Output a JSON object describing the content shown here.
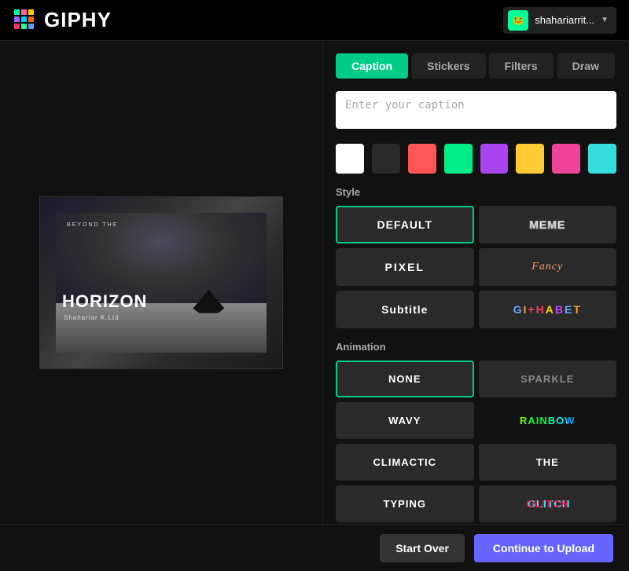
{
  "header": {
    "logo_text": "GIPHY",
    "user_name": "shahariarrit...",
    "user_avatar_emoji": "🐸",
    "chevron": "▼"
  },
  "tabs": [
    {
      "id": "caption",
      "label": "Caption",
      "active": true
    },
    {
      "id": "stickers",
      "label": "Stickers",
      "active": false
    },
    {
      "id": "filters",
      "label": "Filters",
      "active": false
    },
    {
      "id": "draw",
      "label": "Draw",
      "active": false
    }
  ],
  "caption": {
    "placeholder": "Enter your caption",
    "value": ""
  },
  "colors": [
    {
      "id": "white",
      "hex": "#ffffff",
      "active": true
    },
    {
      "id": "black",
      "hex": "#2a2a2a",
      "active": false
    },
    {
      "id": "red",
      "hex": "#ff5555",
      "active": false
    },
    {
      "id": "green",
      "hex": "#00ee88",
      "active": false
    },
    {
      "id": "purple",
      "hex": "#aa44ee",
      "active": false
    },
    {
      "id": "yellow",
      "hex": "#ffcc33",
      "active": false
    },
    {
      "id": "pink",
      "hex": "#ee4499",
      "active": false
    },
    {
      "id": "cyan",
      "hex": "#33dddd",
      "active": false
    }
  ],
  "style_section": {
    "label": "Style",
    "options": [
      {
        "id": "default",
        "label": "DEFAULT",
        "active": true,
        "type": "default"
      },
      {
        "id": "meme",
        "label": "MEME",
        "active": false,
        "type": "meme"
      },
      {
        "id": "pixel",
        "label": "PIXEL",
        "active": false,
        "type": "pixel"
      },
      {
        "id": "fancy",
        "label": "Fancy",
        "active": false,
        "type": "fancy"
      },
      {
        "id": "subtitle",
        "label": "Subtitle",
        "active": false,
        "type": "subtitle"
      },
      {
        "id": "alphabet",
        "label": "GIPHABET",
        "active": false,
        "type": "alphabet"
      }
    ]
  },
  "animation_section": {
    "label": "Animation",
    "options": [
      {
        "id": "none",
        "label": "NONE",
        "active": true,
        "type": "none"
      },
      {
        "id": "sparkle",
        "label": "SPARKLE",
        "active": false,
        "type": "sparkle"
      },
      {
        "id": "wavy",
        "label": "WAVY",
        "active": false,
        "type": "wavy"
      },
      {
        "id": "rainbow",
        "label": "RAINBOW",
        "active": false,
        "type": "rainbow"
      },
      {
        "id": "climactic",
        "label": "CLIMACTIC",
        "active": false,
        "type": "climactic"
      },
      {
        "id": "the",
        "label": "THE",
        "active": false,
        "type": "the"
      },
      {
        "id": "typing",
        "label": "TYPING",
        "active": false,
        "type": "typing"
      },
      {
        "id": "glitch",
        "label": "GLITCH",
        "active": false,
        "type": "glitch"
      }
    ]
  },
  "footer": {
    "start_over_label": "Start Over",
    "continue_label": "Continue to Upload"
  },
  "preview": {
    "small_text": "BEYOND THE",
    "title": "HORIZON",
    "subtitle": "Shahariar K.Ltd"
  }
}
